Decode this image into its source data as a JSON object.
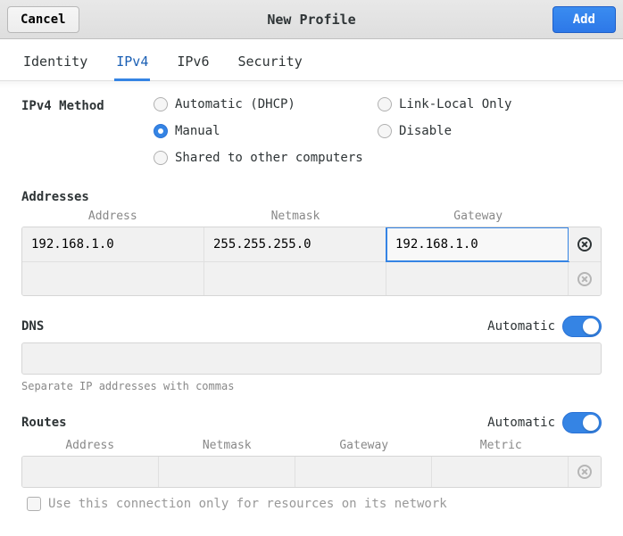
{
  "header": {
    "cancel": "Cancel",
    "title": "New Profile",
    "add": "Add"
  },
  "tabs": {
    "identity": "Identity",
    "ipv4": "IPv4",
    "ipv6": "IPv6",
    "security": "Security"
  },
  "method": {
    "label": "IPv4 Method",
    "options": {
      "auto": "Automatic (DHCP)",
      "link_local": "Link-Local Only",
      "manual": "Manual",
      "disable": "Disable",
      "shared": "Shared to other computers"
    }
  },
  "addresses": {
    "title": "Addresses",
    "headers": {
      "address": "Address",
      "netmask": "Netmask",
      "gateway": "Gateway"
    },
    "rows": [
      {
        "address": "192.168.1.0",
        "netmask": "255.255.255.0",
        "gateway": "192.168.1.0"
      },
      {
        "address": "",
        "netmask": "",
        "gateway": ""
      }
    ]
  },
  "dns": {
    "title": "DNS",
    "automatic_label": "Automatic",
    "hint": "Separate IP addresses with commas"
  },
  "routes": {
    "title": "Routes",
    "automatic_label": "Automatic",
    "headers": {
      "address": "Address",
      "netmask": "Netmask",
      "gateway": "Gateway",
      "metric": "Metric"
    }
  },
  "footer": {
    "only_for_resources": "Use this connection only for resources on its network"
  }
}
